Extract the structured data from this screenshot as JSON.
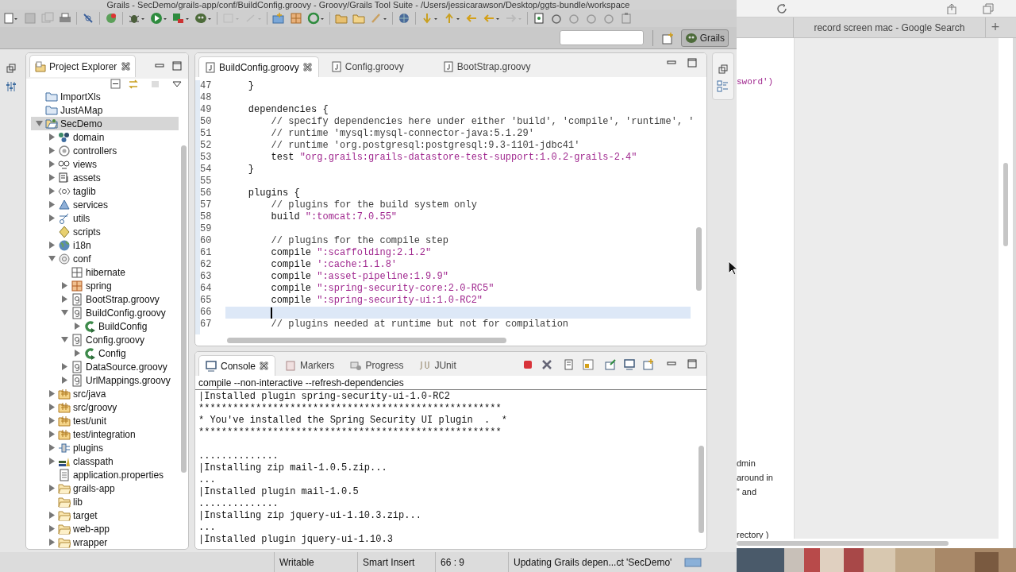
{
  "window": {
    "title": "Grails - SecDemo/grails-app/conf/BuildConfig.groovy - Groovy/Grails Tool Suite - /Users/jessicarawson/Desktop/ggts-bundle/workspace"
  },
  "perspective": {
    "label": "Grails",
    "selected": true
  },
  "project_explorer": {
    "title": "Project Explorer",
    "tree": [
      {
        "label": "ImportXls",
        "kind": "project",
        "leaf": true,
        "selected": false
      },
      {
        "label": "JustAMap",
        "kind": "project",
        "leaf": true,
        "selected": false
      },
      {
        "label": "SecDemo",
        "kind": "grails-project",
        "leaf": false,
        "expanded": true,
        "selected": true,
        "children": [
          {
            "label": "domain",
            "kind": "domain",
            "leaf": false,
            "expanded": false,
            "selected": false
          },
          {
            "label": "controllers",
            "kind": "controllers",
            "leaf": false,
            "expanded": false,
            "selected": false
          },
          {
            "label": "views",
            "kind": "views",
            "leaf": false,
            "expanded": false,
            "selected": false
          },
          {
            "label": "assets",
            "kind": "assets",
            "leaf": false,
            "expanded": false,
            "selected": false
          },
          {
            "label": "taglib",
            "kind": "taglib",
            "leaf": false,
            "expanded": false,
            "selected": false
          },
          {
            "label": "services",
            "kind": "services",
            "leaf": false,
            "expanded": false,
            "selected": false
          },
          {
            "label": "utils",
            "kind": "utils",
            "leaf": false,
            "expanded": false,
            "selected": false
          },
          {
            "label": "scripts",
            "kind": "scripts",
            "leaf": true,
            "selected": false
          },
          {
            "label": "i18n",
            "kind": "i18n",
            "leaf": false,
            "expanded": false,
            "selected": false
          },
          {
            "label": "conf",
            "kind": "conf",
            "leaf": false,
            "expanded": true,
            "selected": false,
            "children": [
              {
                "label": "hibernate",
                "kind": "grid",
                "leaf": true,
                "selected": false
              },
              {
                "label": "spring",
                "kind": "spring",
                "leaf": false,
                "expanded": false,
                "selected": false
              },
              {
                "label": "BootStrap.groovy",
                "kind": "groovy",
                "leaf": false,
                "expanded": false,
                "selected": false
              },
              {
                "label": "BuildConfig.groovy",
                "kind": "groovy",
                "leaf": false,
                "expanded": true,
                "selected": false,
                "children": [
                  {
                    "label": "BuildConfig",
                    "kind": "class",
                    "leaf": false,
                    "expanded": false,
                    "selected": false
                  }
                ]
              },
              {
                "label": "Config.groovy",
                "kind": "groovy",
                "leaf": false,
                "expanded": true,
                "selected": false,
                "children": [
                  {
                    "label": "Config",
                    "kind": "class",
                    "leaf": false,
                    "expanded": false,
                    "selected": false
                  }
                ]
              },
              {
                "label": "DataSource.groovy",
                "kind": "groovy",
                "leaf": false,
                "expanded": false,
                "selected": false
              },
              {
                "label": "UrlMappings.groovy",
                "kind": "groovy",
                "leaf": false,
                "expanded": false,
                "selected": false
              }
            ]
          },
          {
            "label": "src/java",
            "kind": "package",
            "leaf": false,
            "expanded": false,
            "selected": false
          },
          {
            "label": "src/groovy",
            "kind": "package",
            "leaf": false,
            "expanded": false,
            "selected": false
          },
          {
            "label": "test/unit",
            "kind": "package",
            "leaf": false,
            "expanded": false,
            "selected": false
          },
          {
            "label": "test/integration",
            "kind": "package",
            "leaf": false,
            "expanded": false,
            "selected": false
          },
          {
            "label": "plugins",
            "kind": "plugins",
            "leaf": false,
            "expanded": false,
            "selected": false
          },
          {
            "label": "classpath",
            "kind": "classpath",
            "leaf": false,
            "expanded": false,
            "selected": false
          },
          {
            "label": "application.properties",
            "kind": "file",
            "leaf": true,
            "selected": false
          },
          {
            "label": "grails-app",
            "kind": "folder",
            "leaf": false,
            "expanded": false,
            "selected": false
          },
          {
            "label": "lib",
            "kind": "folder",
            "leaf": true,
            "selected": false
          },
          {
            "label": "target",
            "kind": "folder",
            "leaf": false,
            "expanded": false,
            "selected": false
          },
          {
            "label": "web-app",
            "kind": "folder",
            "leaf": false,
            "expanded": false,
            "selected": false
          },
          {
            "label": "wrapper",
            "kind": "folder",
            "leaf": false,
            "expanded": false,
            "selected": false
          }
        ]
      }
    ]
  },
  "editor": {
    "tabs": [
      {
        "label": "BuildConfig.groovy",
        "selected": true
      },
      {
        "label": "Config.groovy",
        "selected": false
      },
      {
        "label": "BootStrap.groovy",
        "selected": false
      }
    ],
    "lines": [
      {
        "number": "47",
        "current": false,
        "segments": [
          {
            "kind": "code",
            "text": "    }"
          }
        ]
      },
      {
        "number": "48",
        "current": false
      },
      {
        "number": "49",
        "current": false,
        "segments": [
          {
            "kind": "code",
            "text": "    dependencies {"
          }
        ]
      },
      {
        "number": "50",
        "current": false,
        "segments": [
          {
            "kind": "comment",
            "text": "        // specify dependencies here under either 'build', 'compile', 'runtime', '"
          }
        ]
      },
      {
        "number": "51",
        "current": false,
        "segments": [
          {
            "kind": "comment",
            "text": "        // runtime 'mysql:mysql-connector-java:5.1.29'"
          }
        ]
      },
      {
        "number": "52",
        "current": false,
        "segments": [
          {
            "kind": "comment",
            "text": "        // runtime 'org.postgresql:postgresql:9.3-1101-jdbc41'"
          }
        ]
      },
      {
        "number": "53",
        "current": false,
        "segments": [
          {
            "kind": "code",
            "text": "        test "
          },
          {
            "kind": "string",
            "text": "\"org.grails:grails-datastore-test-support:1.0.2-grails-2.4\""
          }
        ]
      },
      {
        "number": "54",
        "current": false,
        "segments": [
          {
            "kind": "code",
            "text": "    }"
          }
        ]
      },
      {
        "number": "55",
        "current": false
      },
      {
        "number": "56",
        "current": false,
        "segments": [
          {
            "kind": "code",
            "text": "    plugins {"
          }
        ]
      },
      {
        "number": "57",
        "current": false,
        "segments": [
          {
            "kind": "comment",
            "text": "        // plugins for the build system only"
          }
        ]
      },
      {
        "number": "58",
        "current": false,
        "segments": [
          {
            "kind": "code",
            "text": "        build "
          },
          {
            "kind": "string",
            "text": "\":tomcat:7.0.55\""
          }
        ]
      },
      {
        "number": "59",
        "current": false
      },
      {
        "number": "60",
        "current": false,
        "segments": [
          {
            "kind": "comment",
            "text": "        // plugins for the compile step"
          }
        ]
      },
      {
        "number": "61",
        "current": false,
        "segments": [
          {
            "kind": "code",
            "text": "        compile "
          },
          {
            "kind": "string",
            "text": "\":scaffolding:2.1.2\""
          }
        ]
      },
      {
        "number": "62",
        "current": false,
        "segments": [
          {
            "kind": "code",
            "text": "        compile "
          },
          {
            "kind": "string",
            "text": "':cache:1.1.8'"
          }
        ]
      },
      {
        "number": "63",
        "current": false,
        "segments": [
          {
            "kind": "code",
            "text": "        compile "
          },
          {
            "kind": "string",
            "text": "\":asset-pipeline:1.9.9\""
          }
        ]
      },
      {
        "number": "64",
        "current": false,
        "segments": [
          {
            "kind": "code",
            "text": "        compile "
          },
          {
            "kind": "string",
            "text": "\":spring-security-core:2.0-RC5\""
          }
        ]
      },
      {
        "number": "65",
        "current": false,
        "segments": [
          {
            "kind": "code",
            "text": "        compile "
          },
          {
            "kind": "string",
            "text": "\":spring-security-ui:1.0-RC2\""
          }
        ]
      },
      {
        "number": "66",
        "current": true
      },
      {
        "number": "67",
        "current": false,
        "segments": [
          {
            "kind": "comment",
            "text": "        // plugins needed at runtime but not for compilation"
          }
        ]
      }
    ]
  },
  "console": {
    "tabs": [
      {
        "label": "Console",
        "selected": true
      },
      {
        "label": "Markers",
        "selected": false
      },
      {
        "label": "Progress",
        "selected": false
      },
      {
        "label": "JUnit",
        "selected": false
      }
    ],
    "command": "compile --non-interactive --refresh-dependencies",
    "lines": [
      "|Installed plugin spring-security-ui-1.0-RC2",
      "*****************************************************",
      "* You've installed the Spring Security UI plugin  .  *",
      "*****************************************************",
      "..............",
      "|Installing zip mail-1.0.5.zip...",
      "...",
      "|Installed plugin mail-1.0.5",
      "..............",
      "|Installing zip jquery-ui-1.10.3.zip...",
      "...",
      "|Installed plugin jquery-ui-1.10.3"
    ]
  },
  "status_bar": {
    "items": [
      "Writable",
      "Smart Insert",
      "66 : 9",
      "Updating Grails depen...ct 'SecDemo'"
    ]
  },
  "browser": {
    "tab": "record screen mac - Google Search",
    "new_tab": "+",
    "fragments": [
      {
        "kind": "code",
        "text": "sword')"
      },
      {
        "kind": "text",
        "text": "dmin"
      },
      {
        "kind": "text",
        "text": "around in"
      },
      {
        "kind": "text",
        "text": "” and"
      },
      {
        "kind": "text",
        "text": "rectory )"
      }
    ]
  }
}
